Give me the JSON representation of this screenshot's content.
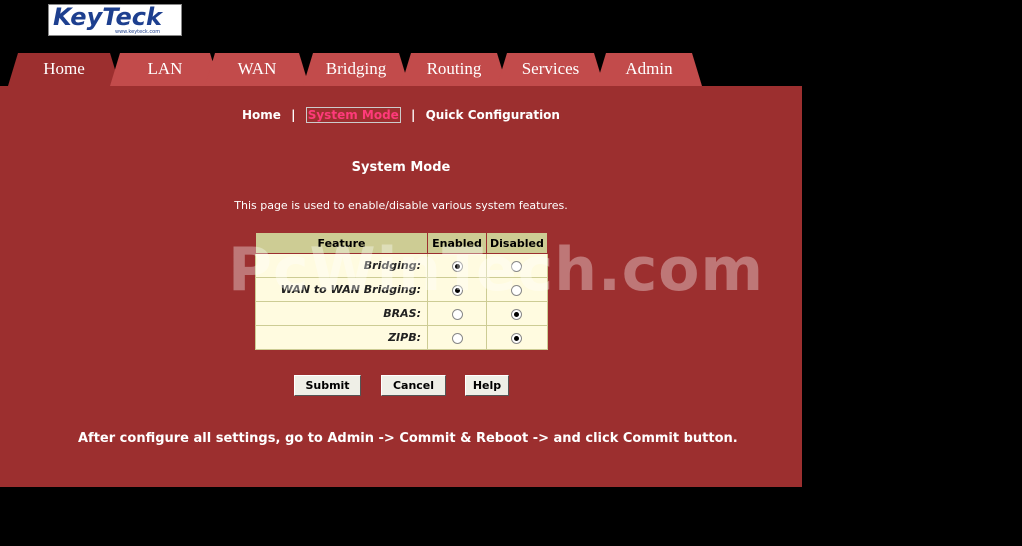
{
  "logo": {
    "name": "KeyTeck",
    "sub": "www.keyteck.com"
  },
  "tabs": [
    {
      "label": "Home"
    },
    {
      "label": "LAN"
    },
    {
      "label": "WAN"
    },
    {
      "label": "Bridging"
    },
    {
      "label": "Routing"
    },
    {
      "label": "Services"
    },
    {
      "label": "Admin"
    }
  ],
  "active_tab": "Home",
  "subnav": {
    "home": "Home",
    "system_mode": "System Mode",
    "quick": "Quick Configuration",
    "sep": "|"
  },
  "page": {
    "title": "System Mode",
    "description": "This page is used to enable/disable various system features."
  },
  "table": {
    "headers": [
      "Feature",
      "Enabled",
      "Disabled"
    ],
    "rows": [
      {
        "label": "Bridging:",
        "enabled": true
      },
      {
        "label": "WAN to WAN Bridging:",
        "enabled": true
      },
      {
        "label": "BRAS:",
        "enabled": false
      },
      {
        "label": "ZIPB:",
        "enabled": false
      }
    ]
  },
  "buttons": {
    "submit": "Submit",
    "cancel": "Cancel",
    "help": "Help"
  },
  "note": "After configure all settings, go to Admin -> Commit & Reboot -> and click Commit button.",
  "watermark": "PcWinTech.com",
  "colors": {
    "panel": "#9c2f2f",
    "tab": "#c24b4b",
    "table_header": "#cdcc94"
  }
}
